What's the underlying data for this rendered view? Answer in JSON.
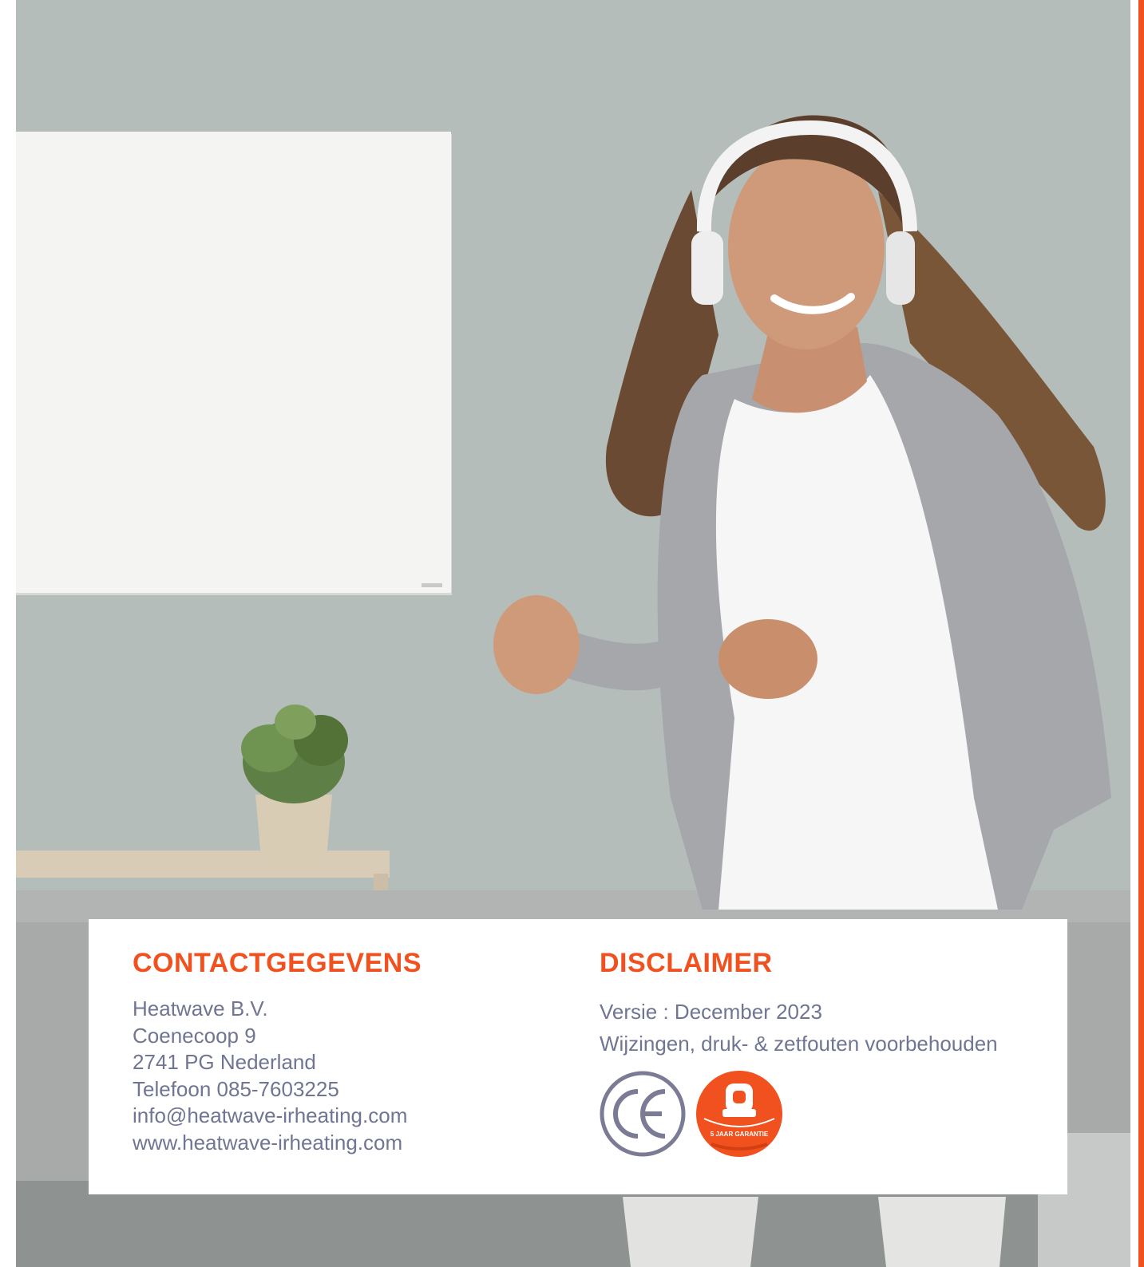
{
  "contact": {
    "heading": "CONTACTGEGEVENS",
    "company": "Heatwave B.V.",
    "street": "Coenecoop 9",
    "postal_city": "2741 PG Nederland",
    "phone": "Telefoon 085-7603225",
    "email": "info@heatwave-irheating.com",
    "website": "www.heatwave-irheating.com"
  },
  "disclaimer": {
    "heading": "DISCLAIMER",
    "version": "Versie : December 2023",
    "notice": "Wijzingen, druk- & zetfouten voorbehouden"
  },
  "marks": {
    "ce_mark": "CE",
    "guarantee_badge": "5 JAAR GARANTIE"
  },
  "colors": {
    "accent": "#f0511e",
    "body_text": "#6f7592",
    "ce_mark": "#7c7b96"
  },
  "icons": [
    "ce-mark-icon",
    "guarantee-badge-icon"
  ]
}
